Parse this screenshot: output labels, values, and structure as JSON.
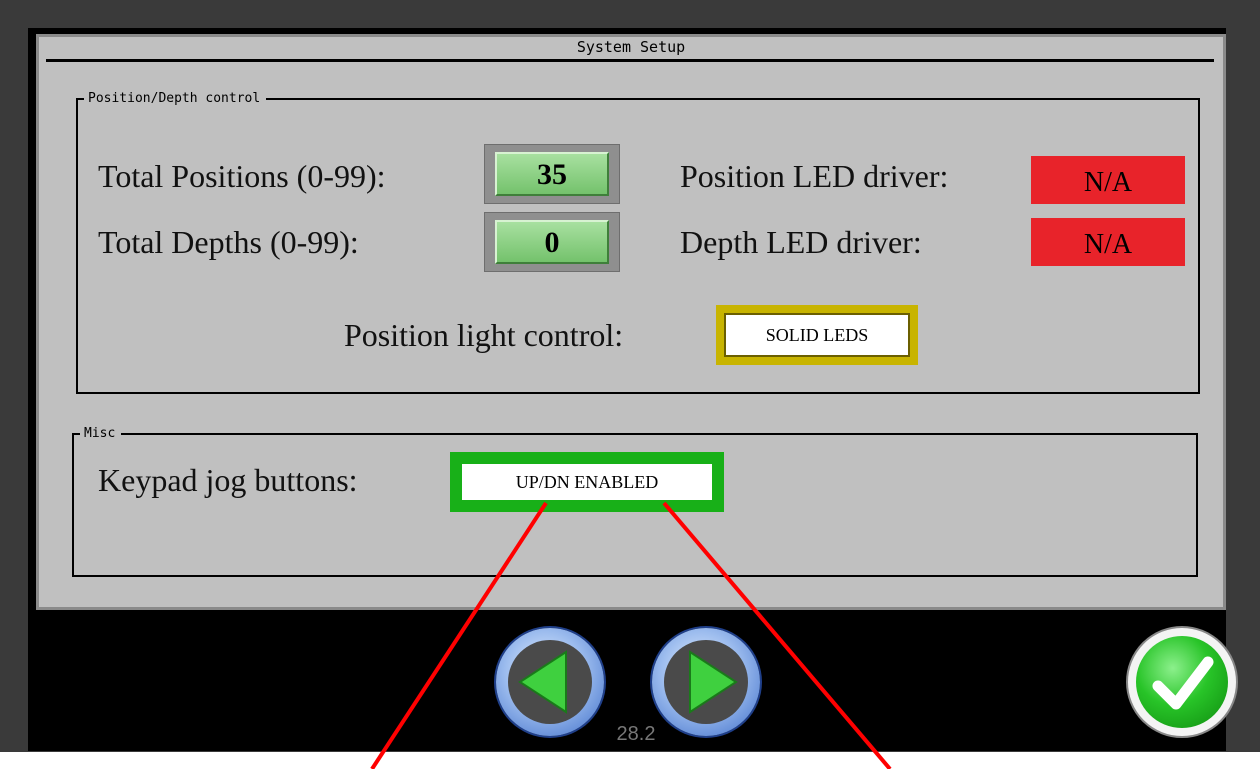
{
  "window": {
    "title": "System Setup"
  },
  "position_depth_group": {
    "legend": "Position/Depth control",
    "total_positions_label": "Total Positions (0-99):",
    "total_positions_value": "35",
    "total_depths_label": "Total Depths (0-99):",
    "total_depths_value": "0",
    "position_led_driver_label": "Position LED driver:",
    "position_led_driver_value": "N/A",
    "depth_led_driver_label": "Depth LED driver:",
    "depth_led_driver_value": "N/A",
    "light_control_label": "Position light control:",
    "light_control_value": "SOLID LEDS"
  },
  "misc_group": {
    "legend": "Misc",
    "jog_label": "Keypad jog buttons:",
    "jog_value": "UP/DN ENABLED"
  },
  "footer": {
    "prev_icon": "left-arrow-icon",
    "next_icon": "right-arrow-icon",
    "page_number": "28.2",
    "confirm_icon": "checkmark-icon"
  },
  "colors": {
    "panel": "#c0c0c0",
    "screen_bg": "#000000",
    "value_green": "#7ccc74",
    "led_red": "#e8232a",
    "light_control_border": "#c8b400",
    "jog_border": "#18b018",
    "callout_red": "#ff0000"
  }
}
